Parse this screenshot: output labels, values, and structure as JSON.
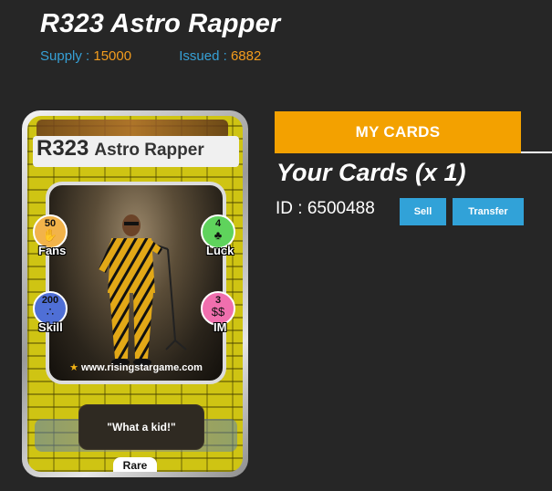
{
  "header": {
    "title": "R323 Astro Rapper",
    "supply_label": "Supply : ",
    "supply_value": "15000",
    "issued_label": "Issued : ",
    "issued_value": "6882"
  },
  "card": {
    "code": "R323",
    "name": "Astro Rapper",
    "stats": {
      "fans": {
        "value": "50",
        "label": "Fans",
        "color": "#f2b34a",
        "icon": "fans-icon"
      },
      "skill": {
        "value": "200",
        "label": "Skill",
        "color": "#4f6fd6",
        "icon": "skill-icon"
      },
      "luck": {
        "value": "4",
        "label": "Luck",
        "color": "#5fd35c",
        "icon": "clover-icon"
      },
      "im": {
        "value": "3",
        "label": "IM",
        "color": "#f06fae",
        "icon": "money-icon"
      }
    },
    "watermark": "www.risingstargame.com",
    "quote": "\"What a kid!\"",
    "rarity": "Rare"
  },
  "panel": {
    "tab_label": "MY CARDS",
    "heading": "Your Cards (x 1)",
    "id_text": "ID : 6500488",
    "sell_label": "Sell",
    "transfer_label": "Transfer"
  },
  "colors": {
    "accent": "#f3a100",
    "button": "#31a2d8",
    "supply_label": "#36a0d6",
    "value": "#f39c1d"
  }
}
